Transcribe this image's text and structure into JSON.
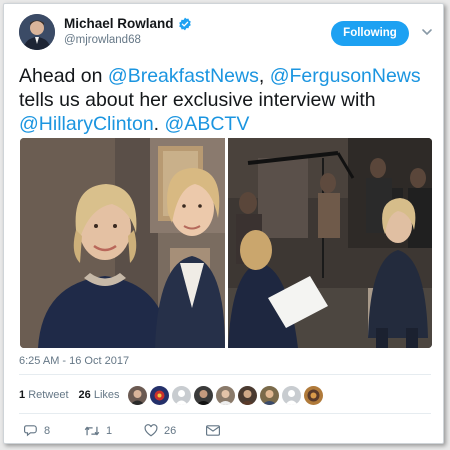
{
  "author": {
    "name": "Michael Rowland",
    "handle": "@mjrowland68",
    "verified": true
  },
  "follow_button": {
    "label": "Following"
  },
  "tweet": {
    "segments": [
      {
        "text": "Ahead on ",
        "link": false
      },
      {
        "text": "@BreakfastNews",
        "link": true
      },
      {
        "text": ", ",
        "link": false
      },
      {
        "text": "@FergusonNews",
        "link": true
      },
      {
        "text": " tells us about her exclusive interview with ",
        "link": false
      },
      {
        "text": "@HillaryClinton",
        "link": true
      },
      {
        "text": ". ",
        "link": false
      },
      {
        "text": "@ABCTV",
        "link": true
      }
    ]
  },
  "timestamp": "6:25 AM - 16 Oct 2017",
  "stats": {
    "retweets_count": "1",
    "retweets_label": "Retweet",
    "likes_count": "26",
    "likes_label": "Likes"
  },
  "liker_avatars": [
    "avatar-1",
    "avatar-2",
    "avatar-3",
    "avatar-4",
    "avatar-5",
    "avatar-6",
    "avatar-7",
    "avatar-8",
    "avatar-9"
  ],
  "actions": {
    "reply_count": "8",
    "retweet_count": "1",
    "like_count": "26"
  },
  "colors": {
    "link": "#1b95e0",
    "button": "#1da1f2",
    "muted": "#657786"
  },
  "icons": [
    "verified-badge-icon",
    "chevron-down-icon",
    "reply-icon",
    "retweet-icon",
    "like-icon",
    "direct-message-icon"
  ]
}
